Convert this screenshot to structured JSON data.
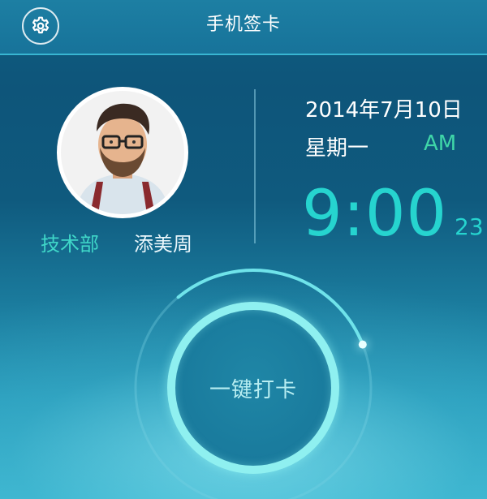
{
  "header": {
    "title": "手机签卡",
    "settings_icon": "gear-icon"
  },
  "profile": {
    "department": "技术部",
    "name": "添美周",
    "avatar": "user-avatar"
  },
  "datetime": {
    "date": "2014年7月10日",
    "weekday": "星期一",
    "ampm": "AM",
    "time": "9:00",
    "seconds": "23"
  },
  "checkin": {
    "label": "一键打卡",
    "progress_fraction": 0.3
  },
  "colors": {
    "accent_teal": "#26d4cf",
    "ampm_green": "#3fd6a8",
    "ring": "#8ff0f0",
    "header_bg": "#1d7fa3"
  }
}
